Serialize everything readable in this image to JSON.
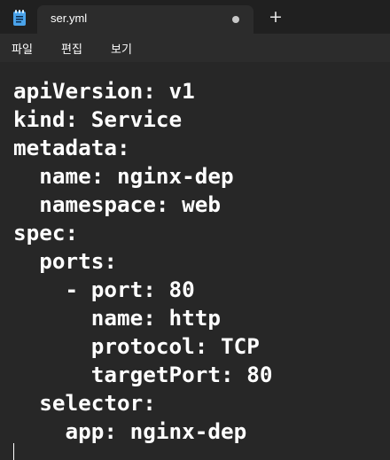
{
  "tab": {
    "title": "ser.yml",
    "modified": true
  },
  "icons": {
    "app": "notepad-icon",
    "new_tab": "plus-icon",
    "unsaved": "unsaved-dot-icon"
  },
  "new_tab_glyph": "+",
  "menu": {
    "items": [
      "파일",
      "편집",
      "보기"
    ]
  },
  "editor": {
    "lines": [
      "apiVersion: v1",
      "kind: Service",
      "metadata:",
      "  name: nginx-dep",
      "  namespace: web",
      "spec:",
      "  ports:",
      "    - port: 80",
      "      name: http",
      "      protocol: TCP",
      "      targetPort: 80",
      "  selector:",
      "    app: nginx-dep"
    ]
  },
  "colors": {
    "background": "#272727",
    "titlebar": "#202020",
    "tab": "#2c2c2c",
    "text": "#ffffff",
    "icon_accent": "#4aa3ea"
  }
}
